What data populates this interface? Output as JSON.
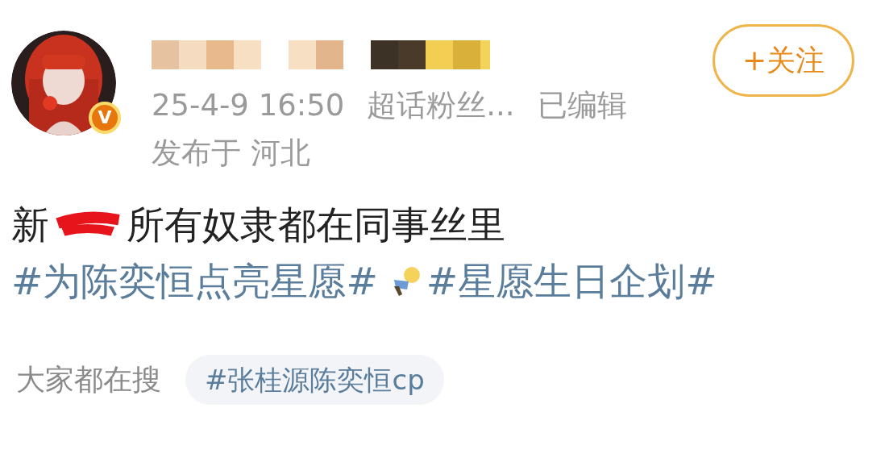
{
  "author": {
    "badge": "V"
  },
  "follow_button": "+关注",
  "meta": {
    "time": "25-4-9 16:50",
    "source": "超话粉丝...",
    "edited": "已编辑",
    "location": "发布于 河北"
  },
  "post": [
    {
      "kind": "text",
      "text": "新"
    },
    {
      "kind": "redaction"
    },
    {
      "kind": "text",
      "text": "所有奴隶都在同事丝里"
    },
    {
      "kind": "topic",
      "text": "#为陈奕恒点亮星愿#"
    },
    {
      "kind": "emoji"
    },
    {
      "kind": "topic",
      "text": "#星愿生日企划#"
    }
  ],
  "trending": {
    "label": "大家都在搜",
    "chips": [
      "#张桂源陈奕恒cp"
    ]
  }
}
